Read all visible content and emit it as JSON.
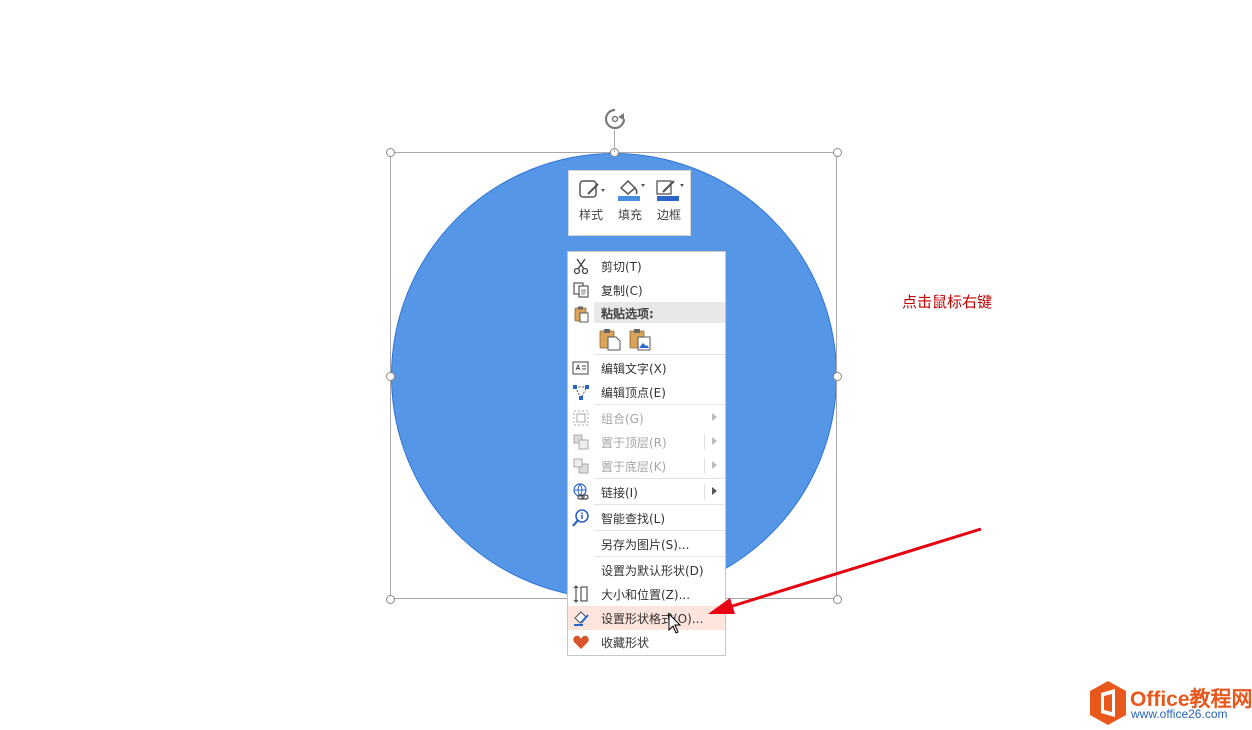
{
  "colors": {
    "shape_fill": "#5596e6",
    "shape_outline": "#2f75d6",
    "annotation": "#c00000",
    "arrow": "#e60012",
    "highlight": "#fde4dc",
    "logo_orange": "#e8581c"
  },
  "mini_toolbar": {
    "buttons": [
      {
        "label": "样式",
        "icon": "style-icon"
      },
      {
        "label": "填充",
        "icon": "fill-bucket-icon"
      },
      {
        "label": "边框",
        "icon": "outline-pen-icon"
      }
    ]
  },
  "context_menu": {
    "items": [
      {
        "label": "剪切(T)",
        "icon": "scissors-icon",
        "enabled": true
      },
      {
        "label": "复制(C)",
        "icon": "copy-icon",
        "enabled": true
      },
      {
        "label": "粘贴选项:",
        "icon": "paste-icon",
        "header": true
      },
      {
        "label": "编辑文字(X)",
        "icon": "edit-text-icon",
        "enabled": true
      },
      {
        "label": "编辑顶点(E)",
        "icon": "edit-points-icon",
        "enabled": true
      },
      {
        "label": "组合(G)",
        "icon": "group-icon",
        "enabled": false,
        "submenu": true
      },
      {
        "label": "置于顶层(R)",
        "icon": "bring-front-icon",
        "enabled": false,
        "submenu": true
      },
      {
        "label": "置于底层(K)",
        "icon": "send-back-icon",
        "enabled": false,
        "submenu": true
      },
      {
        "label": "链接(I)",
        "icon": "link-icon",
        "enabled": true,
        "submenu": true
      },
      {
        "label": "智能查找(L)",
        "icon": "smart-lookup-icon",
        "enabled": true
      },
      {
        "label": "另存为图片(S)...",
        "enabled": true
      },
      {
        "label": "设置为默认形状(D)",
        "enabled": true
      },
      {
        "label": "大小和位置(Z)...",
        "icon": "size-position-icon",
        "enabled": true
      },
      {
        "label": "设置形状格式(O)...",
        "icon": "format-shape-icon",
        "enabled": true,
        "highlighted": true
      },
      {
        "label": "收藏形状",
        "icon": "heart-icon",
        "enabled": true
      }
    ]
  },
  "annotation": {
    "text": "点击鼠标右键"
  },
  "watermark": {
    "title": "Office教程网",
    "url": "www.office26.com"
  }
}
